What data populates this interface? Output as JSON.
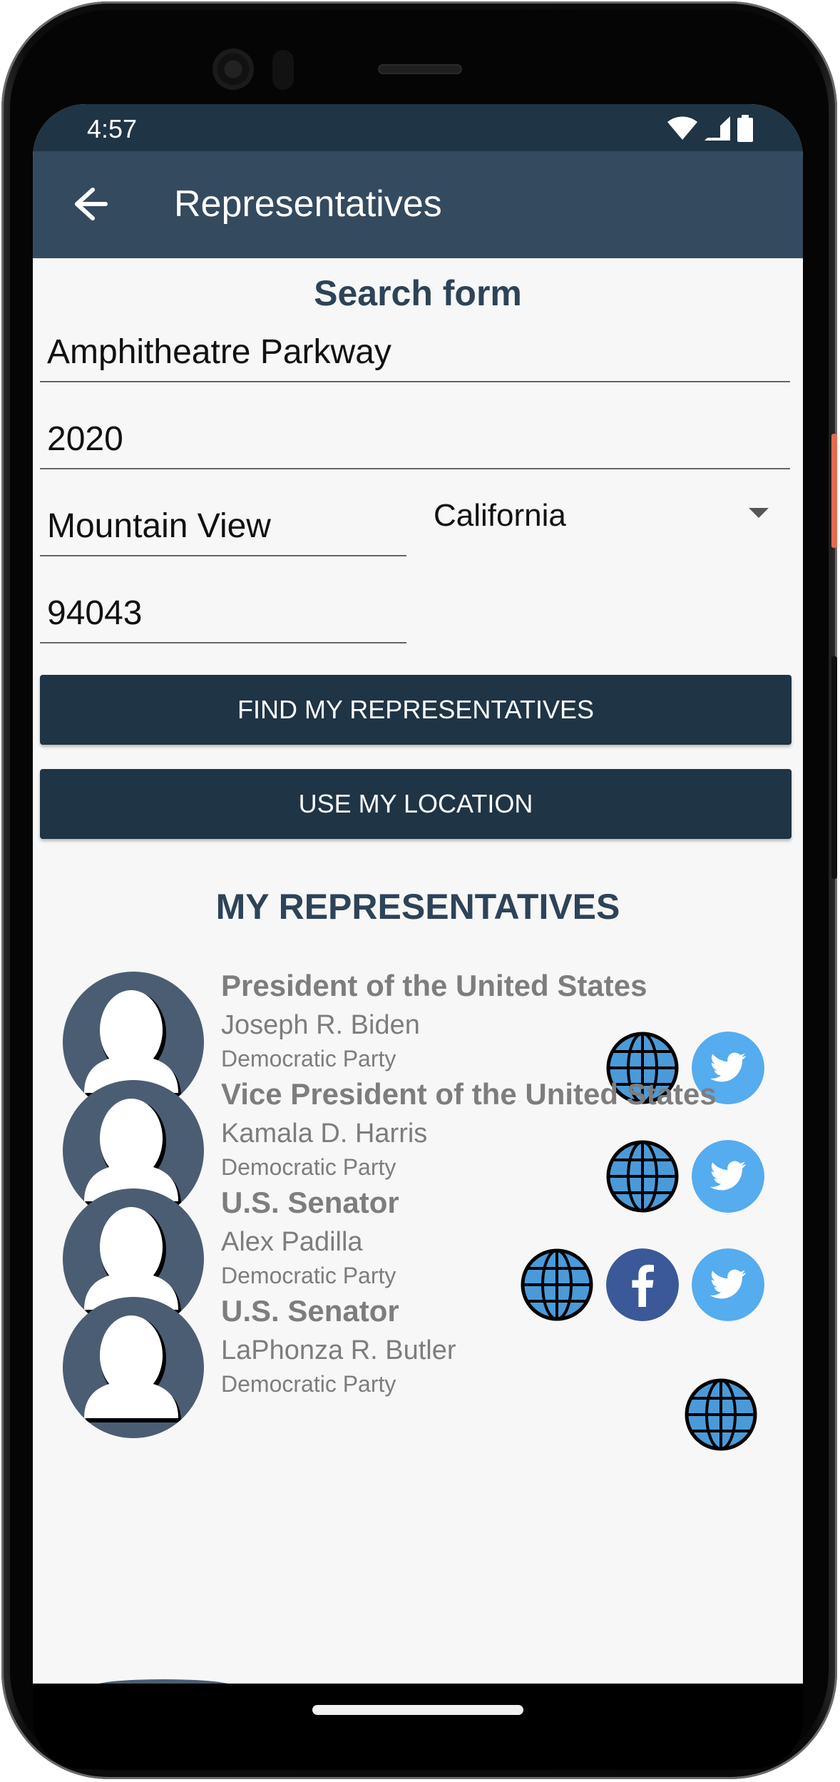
{
  "status": {
    "time": "4:57"
  },
  "appbar": {
    "title": "Representatives"
  },
  "form": {
    "title": "Search form",
    "address_line": "Amphitheatre Parkway",
    "address_number": "2020",
    "city": "Mountain View",
    "state": "California",
    "zip": "94043",
    "find_button": "FIND MY REPRESENTATIVES",
    "location_button": "USE MY LOCATION"
  },
  "representatives": {
    "heading": "MY REPRESENTATIVES",
    "items": [
      {
        "office": "President of the United States",
        "name": "Joseph R. Biden",
        "party": "Democratic Party",
        "links": [
          "web-icon",
          "twitter-icon"
        ]
      },
      {
        "office": "Vice President of the United States",
        "name": "Kamala D. Harris",
        "party": "Democratic Party",
        "links": [
          "web-icon",
          "twitter-icon"
        ]
      },
      {
        "office": "U.S. Senator",
        "name": "Alex Padilla",
        "party": "Democratic Party",
        "links": [
          "web-icon",
          "facebook-icon",
          "twitter-icon"
        ]
      },
      {
        "office": "U.S. Senator",
        "name": "LaPhonza R. Butler",
        "party": "Democratic Party",
        "links": [
          "web-icon"
        ]
      }
    ]
  },
  "colors": {
    "primary": "#1f3445",
    "appbar": "#344a5e",
    "avatar": "#4b5d73",
    "twitter": "#55acee",
    "facebook": "#3b5998",
    "globe": "#4b9ad8"
  }
}
